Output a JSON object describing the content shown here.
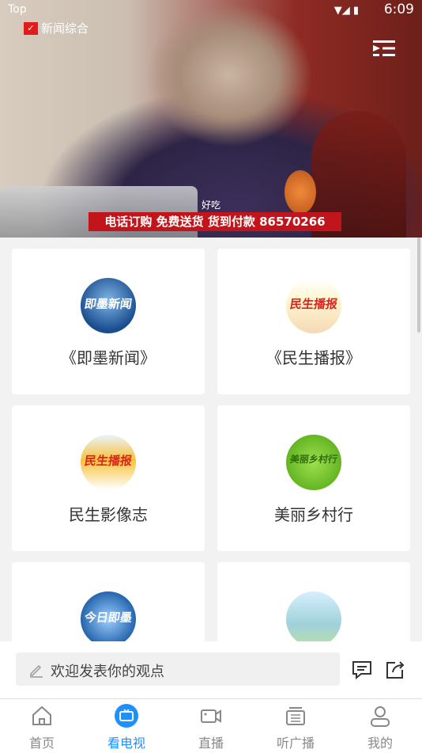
{
  "status_bar": {
    "carrier": "Top",
    "time": "6:09"
  },
  "video": {
    "channel_name": "新闻综合",
    "caption": "好吃",
    "banner": "电话订购 免费送货 货到付款 86570266"
  },
  "programs": [
    {
      "title": "《即墨新闻》",
      "thumb_text": "即墨新闻"
    },
    {
      "title": "《民生播报》",
      "thumb_text": "民生播报"
    },
    {
      "title": "民生影像志",
      "thumb_text": "民生播报"
    },
    {
      "title": "美丽乡村行",
      "thumb_text": "美丽乡村行"
    },
    {
      "title": "",
      "thumb_text": "今日即墨"
    },
    {
      "title": "",
      "thumb_text": ""
    }
  ],
  "comment": {
    "placeholder": "欢迎发表你的观点"
  },
  "tabs": [
    {
      "label": "首页",
      "icon": "home-icon",
      "active": false
    },
    {
      "label": "看电视",
      "icon": "tv-icon",
      "active": true
    },
    {
      "label": "直播",
      "icon": "video-camera-icon",
      "active": false
    },
    {
      "label": "听广播",
      "icon": "radio-icon",
      "active": false
    },
    {
      "label": "我的",
      "icon": "user-icon",
      "active": false
    }
  ],
  "colors": {
    "accent": "#1e90ff",
    "banner_red": "#c1151b"
  }
}
